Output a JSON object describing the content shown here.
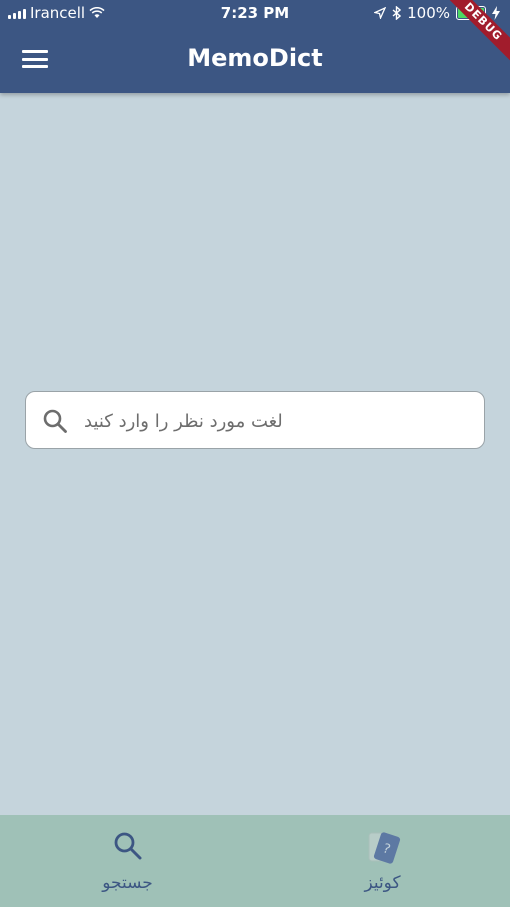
{
  "status_bar": {
    "carrier": "Irancell",
    "time": "7:23 PM",
    "battery": "100%"
  },
  "app_bar": {
    "title": "MemoDict",
    "debug_banner": "DEBUG"
  },
  "search": {
    "placeholder": "لغت مورد نظر را وارد کنید",
    "value": ""
  },
  "bottom_nav": {
    "items": [
      {
        "label": "جستجو",
        "icon": "search-icon"
      },
      {
        "label": "کوئیز",
        "icon": "quiz-card-icon"
      }
    ]
  },
  "colors": {
    "app_bar": "#3c5683",
    "background": "#c5d4dc",
    "bottom_nav": "#9fc1b7",
    "accent": "#3c5683"
  }
}
